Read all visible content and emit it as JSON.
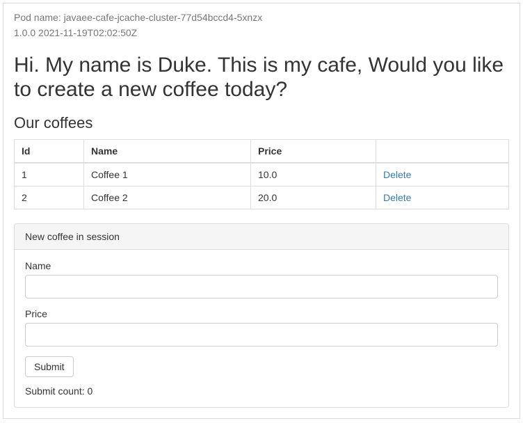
{
  "meta": {
    "pod_name_label": "Pod name: javaee-cafe-jcache-cluster-77d54bccd4-5xnzx",
    "version_ts": "1.0.0 2021-11-19T02:02:50Z"
  },
  "heading": "Hi. My name is Duke. This is my cafe, Would you like to create a new coffee today?",
  "subheading": "Our coffees",
  "table": {
    "headers": {
      "id": "Id",
      "name": "Name",
      "price": "Price",
      "action": ""
    },
    "rows": [
      {
        "id": "1",
        "name": "Coffee 1",
        "price": "10.0",
        "delete": "Delete"
      },
      {
        "id": "2",
        "name": "Coffee 2",
        "price": "20.0",
        "delete": "Delete"
      }
    ]
  },
  "panel": {
    "title": "New coffee in session",
    "name_label": "Name",
    "price_label": "Price",
    "submit_label": "Submit",
    "submit_count_text": "Submit count: 0"
  }
}
